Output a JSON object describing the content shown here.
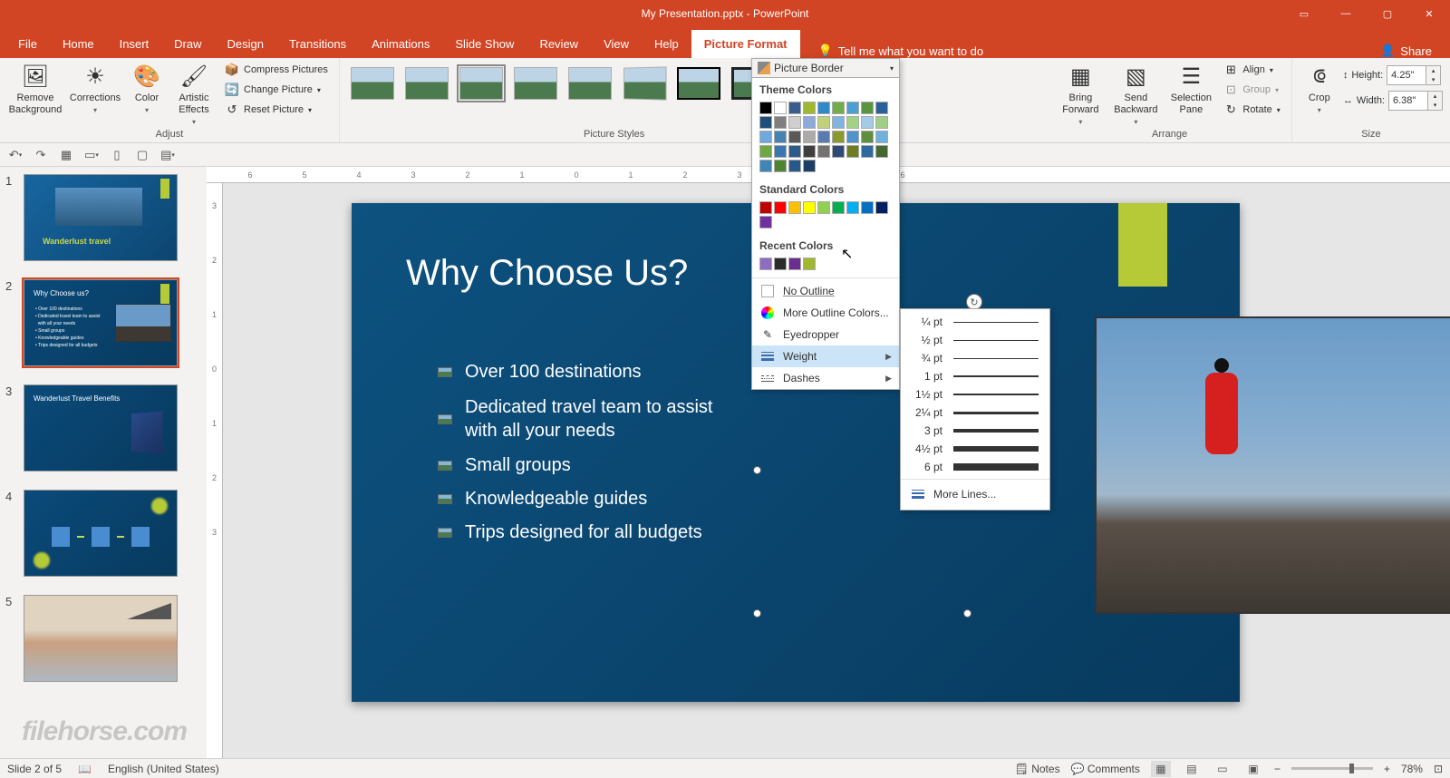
{
  "title": "My Presentation.pptx  -  PowerPoint",
  "tabs": {
    "file": "File",
    "home": "Home",
    "insert": "Insert",
    "draw": "Draw",
    "design": "Design",
    "transitions": "Transitions",
    "animations": "Animations",
    "slideshow": "Slide Show",
    "review": "Review",
    "view": "View",
    "help": "Help",
    "picture_format": "Picture Format"
  },
  "tell_me": "Tell me what you want to do",
  "share": "Share",
  "ribbon": {
    "adjust": {
      "label": "Adjust",
      "remove_bg": "Remove Background",
      "corrections": "Corrections",
      "color": "Color",
      "artistic": "Artistic Effects",
      "compress": "Compress Pictures",
      "change": "Change Picture",
      "reset": "Reset Picture"
    },
    "picture_styles": {
      "label": "Picture Styles"
    },
    "arrange": {
      "label": "Arrange",
      "bring_forward": "Bring Forward",
      "send_backward": "Send Backward",
      "selection_pane": "Selection Pane",
      "align": "Align",
      "group": "Group",
      "rotate": "Rotate"
    },
    "size": {
      "label": "Size",
      "crop": "Crop",
      "height_label": "Height:",
      "height_value": "4.25\"",
      "width_label": "Width:",
      "width_value": "6.38\""
    }
  },
  "picture_border": {
    "button": "Picture Border",
    "theme_colors": "Theme Colors",
    "standard_colors": "Standard Colors",
    "recent_colors": "Recent Colors",
    "no_outline": "No Outline",
    "more_colors": "More Outline Colors...",
    "eyedropper": "Eyedropper",
    "weight": "Weight",
    "dashes": "Dashes"
  },
  "weight_options": {
    "w1": "¼ pt",
    "w2": "½ pt",
    "w3": "¾ pt",
    "w4": "1 pt",
    "w5": "1½ pt",
    "w6": "2¼ pt",
    "w7": "3 pt",
    "w8": "4½ pt",
    "w9": "6 pt",
    "more": "More Lines..."
  },
  "theme_color_hex": [
    "#000000",
    "#ffffff",
    "#3b5c8e",
    "#a0b730",
    "#3188c8",
    "#70ad47",
    "#4e9fd1",
    "#599440",
    "#2a6099",
    "#1f4e79",
    "#7f7f7f",
    "#d0cece",
    "#8ea9db",
    "#c1d37a",
    "#7fb5e0",
    "#a2d283",
    "#a4cbe8",
    "#9fd086",
    "#6fa8dc",
    "#4682b4",
    "#595959",
    "#aeaaaa",
    "#5a7bb0",
    "#8a9a2c",
    "#4e93c9",
    "#5e8e3e",
    "#6eb1dc",
    "#6da845",
    "#3b78b0",
    "#2e5c8a",
    "#3f3f3f",
    "#767171",
    "#2f4b74",
    "#6e7c23",
    "#2d6aa0",
    "#436830",
    "#3f86b5",
    "#4e8330",
    "#27598a",
    "#1c3e63"
  ],
  "standard_color_hex": [
    "#c00000",
    "#ff0000",
    "#ffc000",
    "#ffff00",
    "#92d050",
    "#00b050",
    "#00b0f0",
    "#0070c0",
    "#002060",
    "#7030a0"
  ],
  "recent_color_hex": [
    "#8e6cc0",
    "#2b2b2b",
    "#6b2d8e",
    "#a0b730"
  ],
  "slide_content": {
    "title": "Why Choose Us?",
    "bullets": [
      "Over 100 destinations",
      "Dedicated travel team to assist with all your needs",
      "Small groups",
      "Knowledgeable guides",
      "Trips designed for all budgets"
    ]
  },
  "thumbnails": [
    {
      "title": "Wanderlust travel"
    },
    {
      "title": "Why Choose us?"
    },
    {
      "title": "Wanderlust Travel Benefits"
    },
    {
      "title": ""
    },
    {
      "title": ""
    }
  ],
  "status": {
    "slide_info": "Slide 2 of 5",
    "language": "English (United States)",
    "notes": "Notes",
    "comments": "Comments",
    "zoom": "78%"
  },
  "watermark": "filehorse.com"
}
